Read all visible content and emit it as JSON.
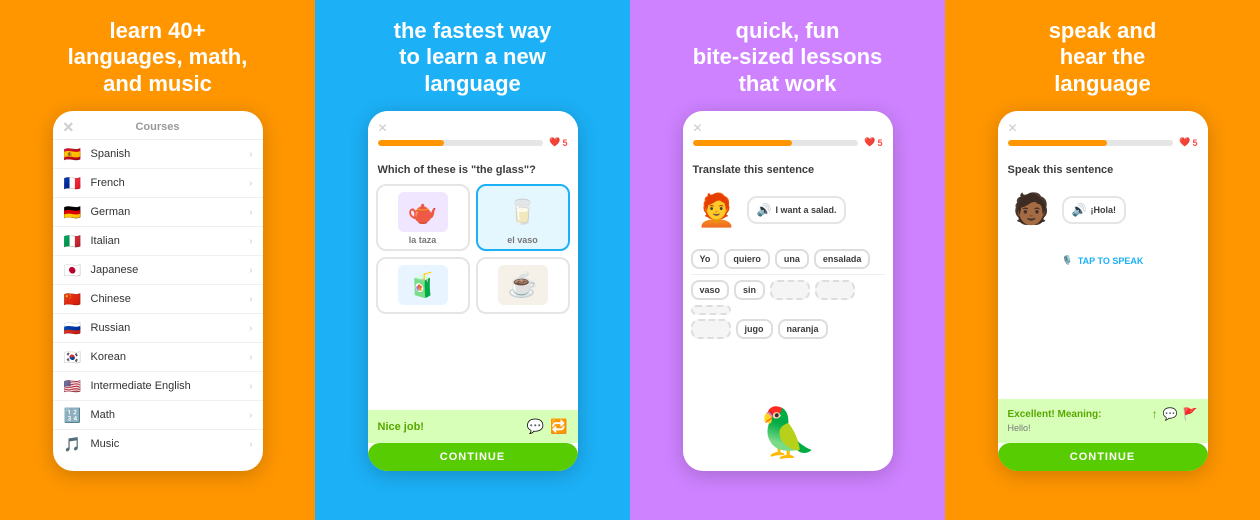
{
  "panels": [
    {
      "id": "panel-1",
      "bg": "#FF9600",
      "title": "learn 40+\nlanguages, math,\nand music",
      "phone": {
        "header": "Courses",
        "courses": [
          {
            "name": "Spanish",
            "flag": "🇪🇸"
          },
          {
            "name": "French",
            "flag": "🇫🇷"
          },
          {
            "name": "German",
            "flag": "🇩🇪"
          },
          {
            "name": "Italian",
            "flag": "🇮🇹"
          },
          {
            "name": "Japanese",
            "flag": "🇯🇵"
          },
          {
            "name": "Chinese",
            "flag": "🇨🇳"
          },
          {
            "name": "Russian",
            "flag": "🇷🇺"
          },
          {
            "name": "Korean",
            "flag": "🇰🇷"
          },
          {
            "name": "Intermediate English",
            "flag": "🇺🇸"
          },
          {
            "name": "Math",
            "flag": "➕"
          },
          {
            "name": "Music",
            "flag": "🎵"
          }
        ]
      }
    },
    {
      "id": "panel-2",
      "bg": "#1CB0F6",
      "title": "the fastest way\nto learn a new\nlanguage",
      "phone": {
        "progress": 40,
        "hearts": 5,
        "question": "Which of these is \"the glass\"?",
        "cards": [
          {
            "label": "la taza",
            "emoji": "🫖",
            "selected": false
          },
          {
            "label": "el vaso",
            "emoji": "🥛",
            "selected": true
          },
          {
            "label": "",
            "emoji": "🧃",
            "selected": false
          },
          {
            "label": "",
            "emoji": "☕",
            "selected": false
          }
        ],
        "nice_job": "Nice job!",
        "continue_label": "CONTINUE"
      }
    },
    {
      "id": "panel-3",
      "bg": "#CE82FF",
      "title": "quick, fun\nbite-sized lessons\nthat work",
      "phone": {
        "progress": 60,
        "hearts": 5,
        "translate_title": "Translate this sentence",
        "speech_text": "I want a salad.",
        "word_chips_top": [
          "Yo",
          "quiero",
          "una",
          "ensalada"
        ],
        "word_chips_bottom": [
          "vaso",
          "sin",
          "",
          "",
          "",
          "jugo",
          "naranja"
        ]
      }
    },
    {
      "id": "panel-4",
      "bg": "#FF9600",
      "title": "speak and\nhear the\nlanguage",
      "phone": {
        "progress": 60,
        "hearts": 5,
        "speak_title": "Speak this sentence",
        "speech_text": "¡Hola!",
        "tap_label": "TAP TO SPEAK",
        "excellent_title": "Excellent! Meaning:",
        "excellent_meaning": "Hello!",
        "continue_label": "CONTINUE"
      }
    }
  ]
}
